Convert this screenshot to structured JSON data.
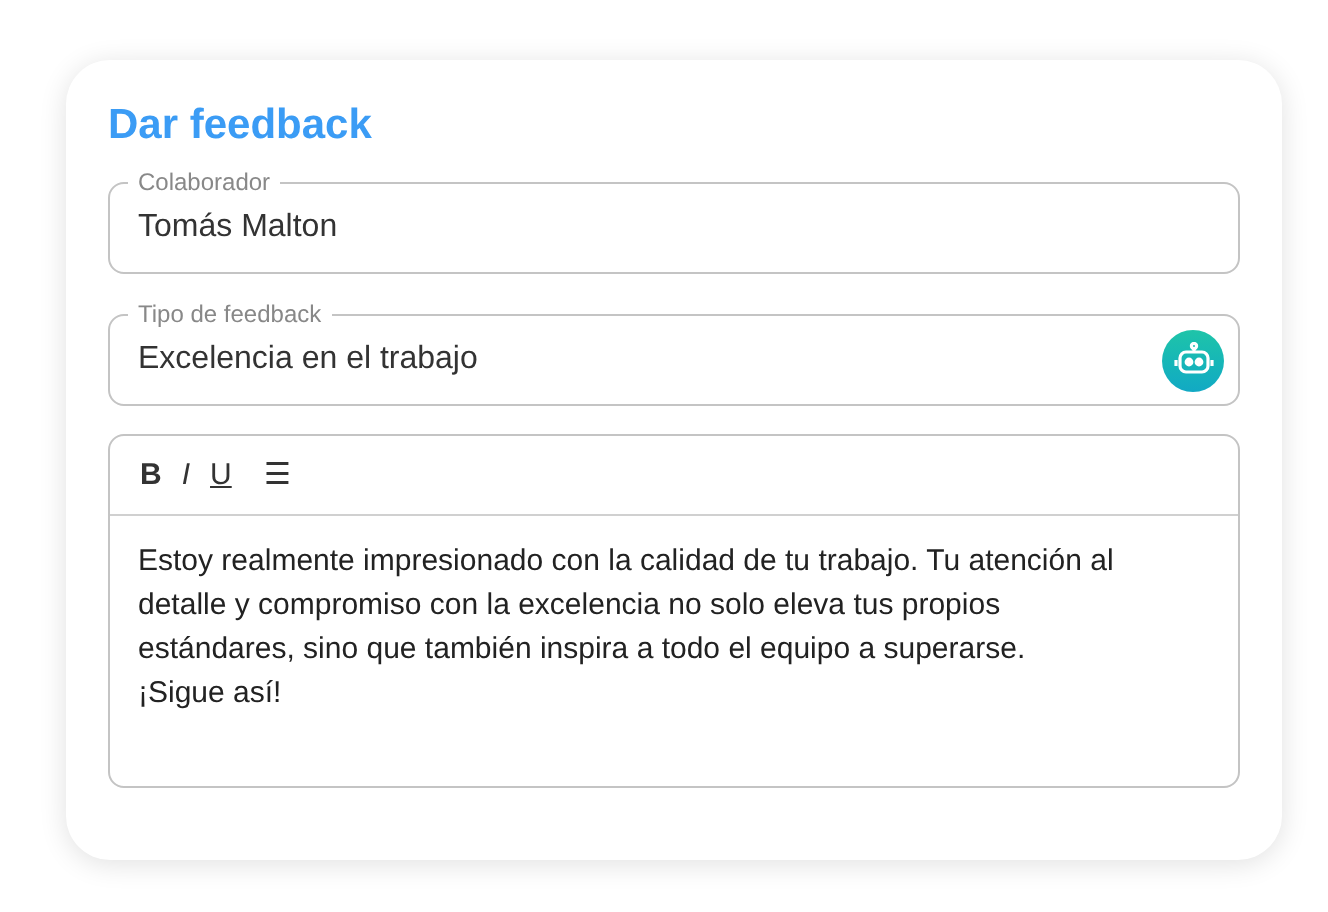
{
  "title": "Dar feedback",
  "fields": [
    {
      "label": "Colaborador",
      "value": "Tomás Malton",
      "kind": "text"
    },
    {
      "label": "Tipo de feedback",
      "value": "Excelencia en el trabajo",
      "kind": "assist"
    }
  ],
  "editor": {
    "toolbar": [
      {
        "label": "B",
        "kind": "bold"
      },
      {
        "label": "I",
        "kind": "italic"
      },
      {
        "label": "U",
        "kind": "underline"
      },
      {
        "label": "☰",
        "kind": "list"
      }
    ],
    "body": "Estoy realmente impresionado con la calidad de tu trabajo. Tu atención al detalle y compromiso con la excelencia no solo eleva tus propios estándares, sino que también inspira a todo el equipo a superarse.\n¡Sigue así!"
  }
}
